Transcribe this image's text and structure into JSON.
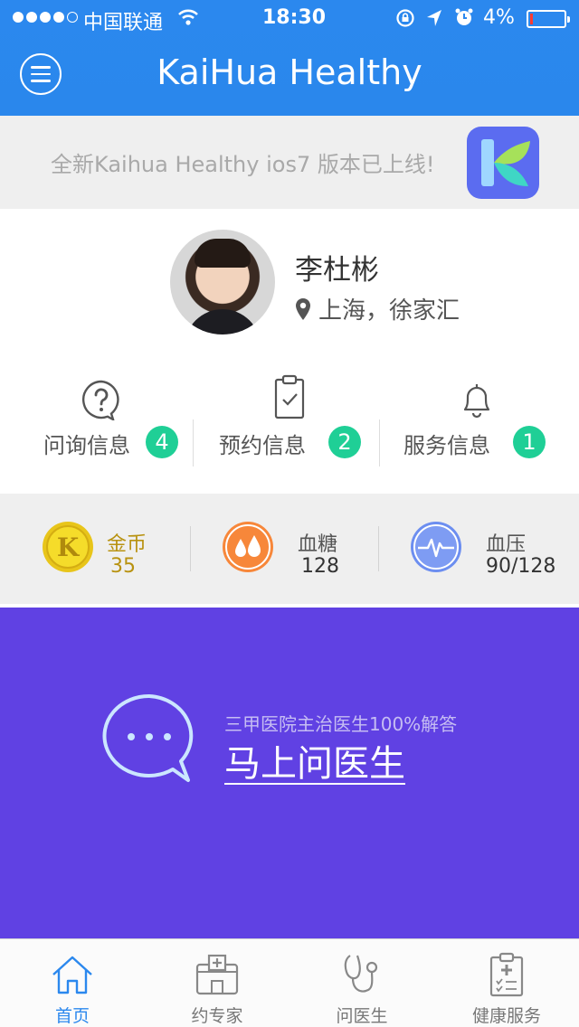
{
  "status_bar": {
    "carrier": "中国联通",
    "time": "18:30",
    "battery": "4%",
    "battery_level": 0.04
  },
  "header": {
    "title": "KaiHua Healthy",
    "menu_icon": "hamburger-menu-icon"
  },
  "banner": {
    "text": "全新Kaihua Healthy ios7 版本已上线!",
    "logo_icon": "kaihua-app-logo"
  },
  "profile": {
    "name": "李杜彬",
    "location": "上海，徐家汇"
  },
  "messages": [
    {
      "label": "问询信息",
      "count": "4",
      "icon": "question-bubble-icon"
    },
    {
      "label": "预约信息",
      "count": "2",
      "icon": "clipboard-check-icon"
    },
    {
      "label": "服务信息",
      "count": "1",
      "icon": "bell-icon"
    }
  ],
  "stats": [
    {
      "name": "金币",
      "value": "35",
      "icon": "gold-coin-icon",
      "color": "#f5dc2a"
    },
    {
      "name": "血糖",
      "value": "128",
      "icon": "blood-drops-icon",
      "color": "#f7873a"
    },
    {
      "name": "血压",
      "value": "90/128",
      "icon": "pulse-wave-icon",
      "color": "#6c8ef0"
    }
  ],
  "cta": {
    "subtitle": "三甲医院主治医生100%解答",
    "title": "马上问医生",
    "icon": "chat-bubble-icon",
    "color": "#6041e3"
  },
  "tabs": [
    {
      "label": "首页",
      "icon": "home-icon",
      "active": true
    },
    {
      "label": "约专家",
      "icon": "hospital-icon",
      "active": false
    },
    {
      "label": "问医生",
      "icon": "stethoscope-icon",
      "active": false
    },
    {
      "label": "健康服务",
      "icon": "medical-clipboard-icon",
      "active": false
    }
  ],
  "colors": {
    "primary": "#2b88ee",
    "badge": "#1fcf96"
  }
}
